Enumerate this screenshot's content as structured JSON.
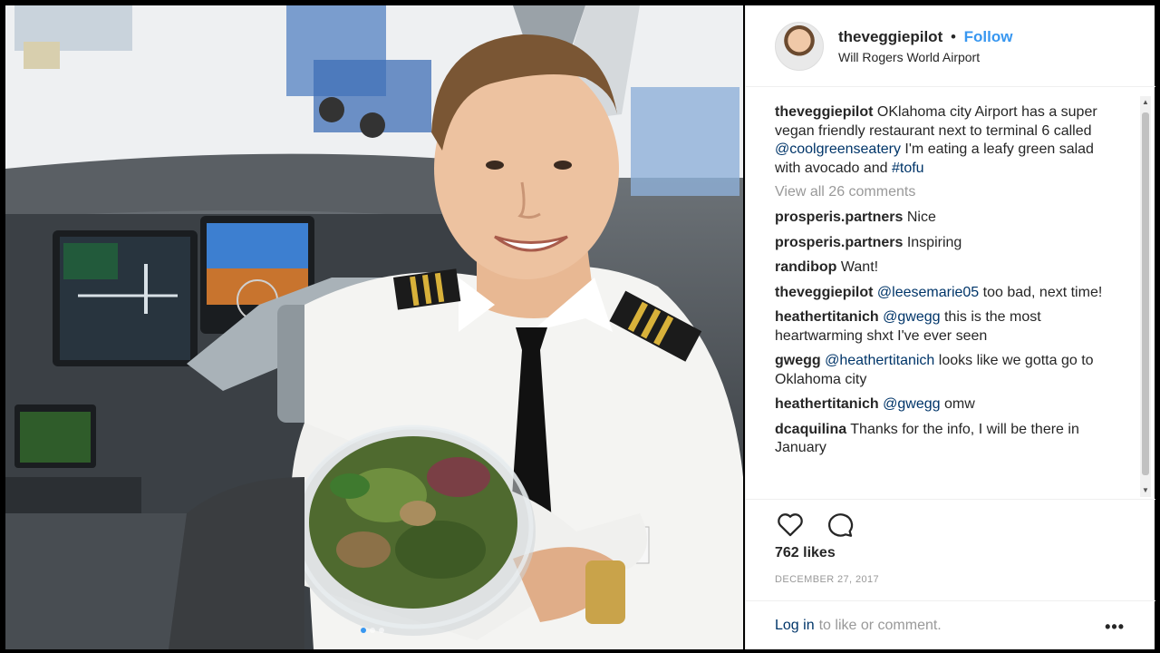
{
  "post": {
    "username": "theveggiepilot",
    "follow_label": "Follow",
    "separator": "•",
    "location": "Will Rogers World Airport",
    "caption": {
      "username": "theveggiepilot",
      "text_before": " OKlahoma city Airport has a super vegan friendly restaurant next to terminal 6 called ",
      "mention": "@coolgreenseatery",
      "text_middle": " I'm eating a leafy green salad with avocado and ",
      "hashtag": "#tofu"
    },
    "view_all_comments": "View all 26 comments",
    "comments": [
      {
        "user": "prosperis.partners",
        "mention": "",
        "text": " Nice"
      },
      {
        "user": "prosperis.partners",
        "mention": "",
        "text": " Inspiring"
      },
      {
        "user": "randibop",
        "mention": "",
        "text": " Want!"
      },
      {
        "user": "theveggiepilot",
        "mention": " @leesemarie05",
        "text": " too bad, next time!"
      },
      {
        "user": "heathertitanich",
        "mention": " @gwegg",
        "text": " this is the most heartwarming shxt I've ever seen"
      },
      {
        "user": "gwegg",
        "mention": " @heathertitanich",
        "text": " looks like we gotta go to Oklahoma city"
      },
      {
        "user": "heathertitanich",
        "mention": " @gwegg",
        "text": " omw"
      },
      {
        "user": "dcaquilina",
        "mention": "",
        "text": " Thanks for the info, I will be there in January"
      }
    ],
    "likes": "762 likes",
    "date": "DECEMBER 27, 2017",
    "login_link": "Log in",
    "login_rest": "to like or comment.",
    "more_options": "•••",
    "icons": {
      "like": "heart-icon",
      "comment": "speech-bubble-icon",
      "more": "more-options-icon"
    },
    "colors": {
      "link": "#3897f0",
      "mention": "#003569",
      "muted": "#999999"
    }
  }
}
